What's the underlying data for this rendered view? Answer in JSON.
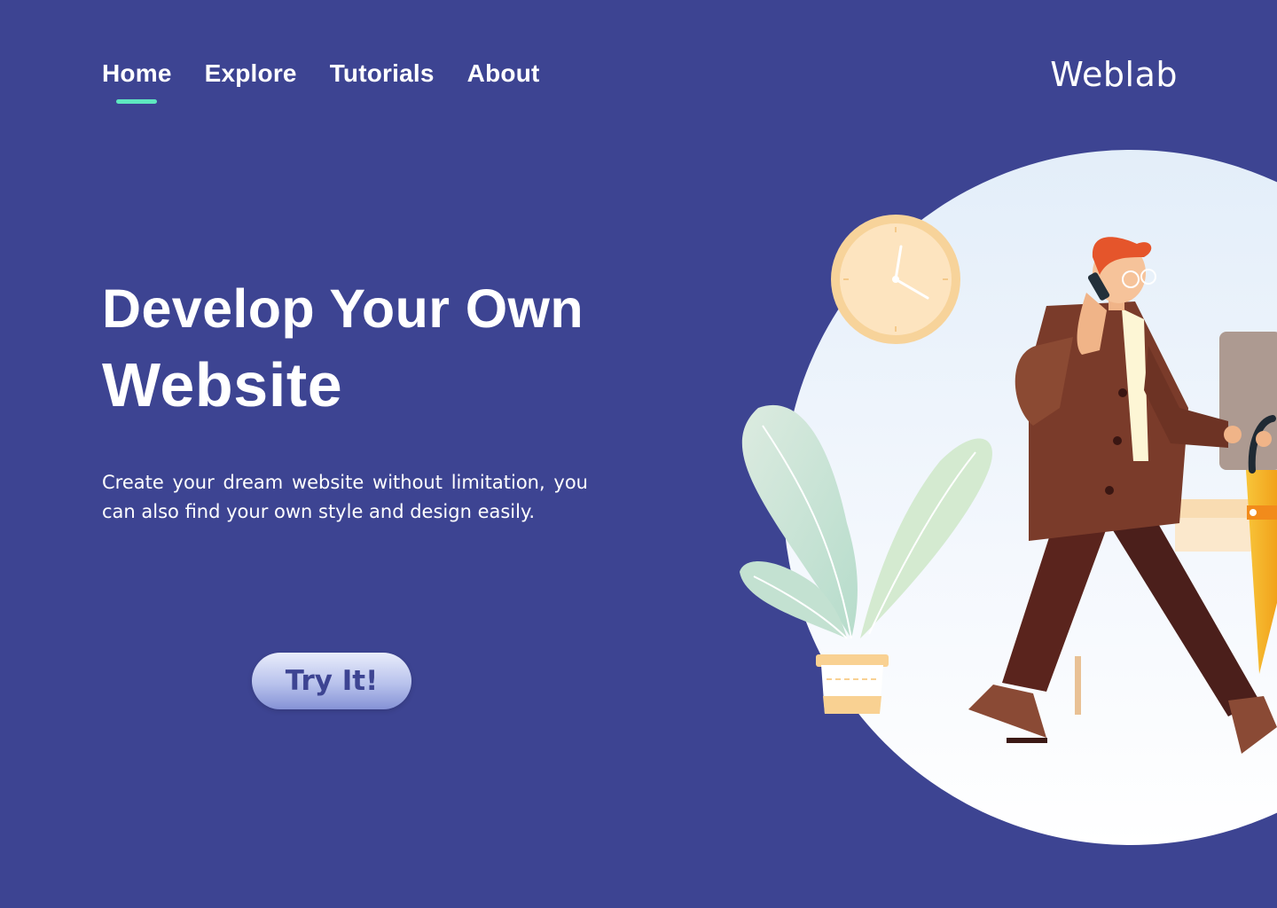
{
  "nav": {
    "items": [
      {
        "label": "Home",
        "active": true
      },
      {
        "label": "Explore",
        "active": false
      },
      {
        "label": "Tutorials",
        "active": false
      },
      {
        "label": "About",
        "active": false
      }
    ],
    "active_color": "#5ee8c0"
  },
  "brand": {
    "name": "Weblab"
  },
  "hero": {
    "title_line1": "Develop Your Own",
    "title_line2": "Website",
    "description": "Create your dream website without  limitation, you can also find your own style and design easily.",
    "cta_label": "Try It!"
  },
  "colors": {
    "background": "#3d4492",
    "text": "#ffffff",
    "accent": "#5ee8c0"
  },
  "illustration": {
    "subject": "man-walking-with-phone",
    "elements": [
      "wall-clock-icon",
      "potted-plant",
      "desk",
      "monitor",
      "umbrella"
    ]
  }
}
